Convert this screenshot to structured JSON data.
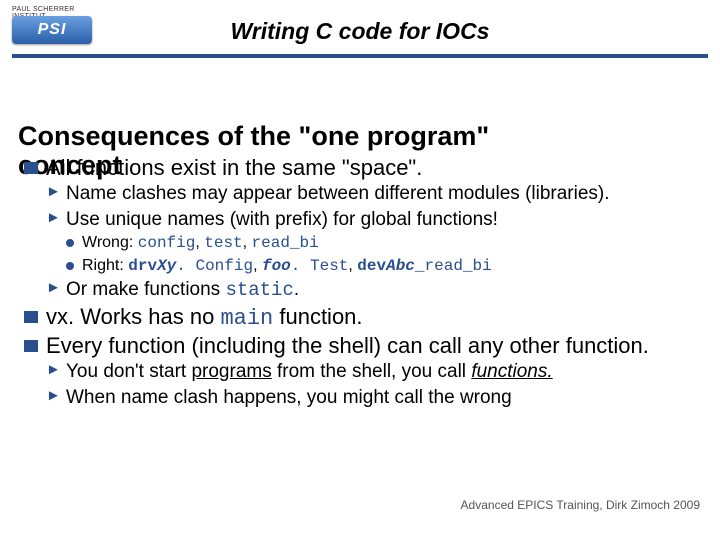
{
  "logo": {
    "institute": "PAUL SCHERRER INSTITUT",
    "badge": "PSI"
  },
  "title": "Writing C code for IOCs",
  "section_l1": "Consequences of the \"one program\"",
  "section_l2": "concept",
  "b1": "All functions exist in the same \"space\".",
  "b1a": "Name clashes may appear between different modules (libraries).",
  "b1b": "Use unique names (with prefix) for global functions!",
  "b1b_wrong_label": "Wrong: ",
  "b1b_wrong1": "config",
  "b1b_wrong2": "test",
  "b1b_wrong3": "read_bi",
  "b1b_right_label": "Right: ",
  "b1b_right1": "drv",
  "b1b_right1b": "Xy",
  "b1b_right1c": ". Config",
  "b1b_right2a": "foo",
  "b1b_right2b": ". Test",
  "b1b_right3a": "dev",
  "b1b_right3b": "Abc",
  "b1b_right3c": "_read_bi",
  "b1c_pre": "Or make functions ",
  "b1c_code": "static",
  "b1c_post": ".",
  "b2_pre": "vx. Works has no ",
  "b2_code": "main",
  "b2_post": " function.",
  "b3": "Every function (including the shell) can call any other function.",
  "b3a_pre": "You don't start ",
  "b3a_u1": "programs",
  "b3a_mid": " from the shell, you call ",
  "b3a_u2": "functions.",
  "b3b_pre": "When name clash happens, you might call the wrong",
  "footer": "Advanced EPICS Training, Dirk Zimoch 2009"
}
